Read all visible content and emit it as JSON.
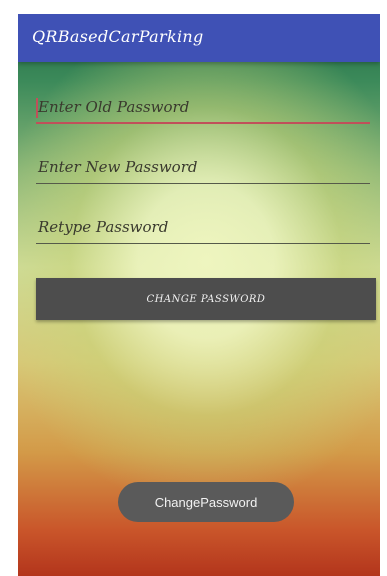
{
  "app": {
    "title": "QRBasedCarParking"
  },
  "form": {
    "old_password_hint": "Enter Old Password",
    "new_password_hint": "Enter New Password",
    "retype_password_hint": "Retype Password"
  },
  "actions": {
    "change_password_label": "CHANGE PASSWORD"
  },
  "toast": {
    "message": "ChangePassword"
  },
  "colors": {
    "appbar": "#3f51b5",
    "button": "#4d4d4d",
    "focus_underline": "#c0505a",
    "toast": "#5a5a5a"
  }
}
